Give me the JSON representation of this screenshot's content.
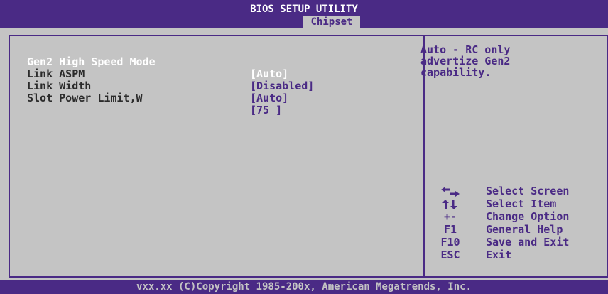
{
  "header": {
    "title": "BIOS SETUP UTILITY",
    "active_tab": "Chipset"
  },
  "settings": [
    {
      "label": "Gen2 High Speed Mode",
      "value": "[Auto]"
    },
    {
      "label": "Link ASPM",
      "value": "[Disabled]"
    },
    {
      "label": "Link Width",
      "value": "[Auto]"
    },
    {
      "label": "Slot Power Limit,W",
      "value": "[75 ]"
    }
  ],
  "help": {
    "text": "Auto - RC only\nadvertize Gen2\ncapability."
  },
  "keys": [
    {
      "icon": "left-right-arrows-icon",
      "desc": "Select Screen"
    },
    {
      "icon": "up-down-arrows-icon",
      "desc": "Select Item"
    },
    {
      "key": "+-",
      "desc": "Change Option"
    },
    {
      "key": "F1",
      "desc": "General Help"
    },
    {
      "key": "F10",
      "desc": "Save and Exit"
    },
    {
      "key": "ESC",
      "desc": "Exit"
    }
  ],
  "footer": {
    "text": "vxx.xx (C)Copyright 1985-200x, American Megatrends, Inc."
  },
  "colors": {
    "background": "#4a2a85",
    "panel": "#c4c4c4",
    "accent_text": "#4a2a85",
    "highlight": "#ffffff"
  }
}
